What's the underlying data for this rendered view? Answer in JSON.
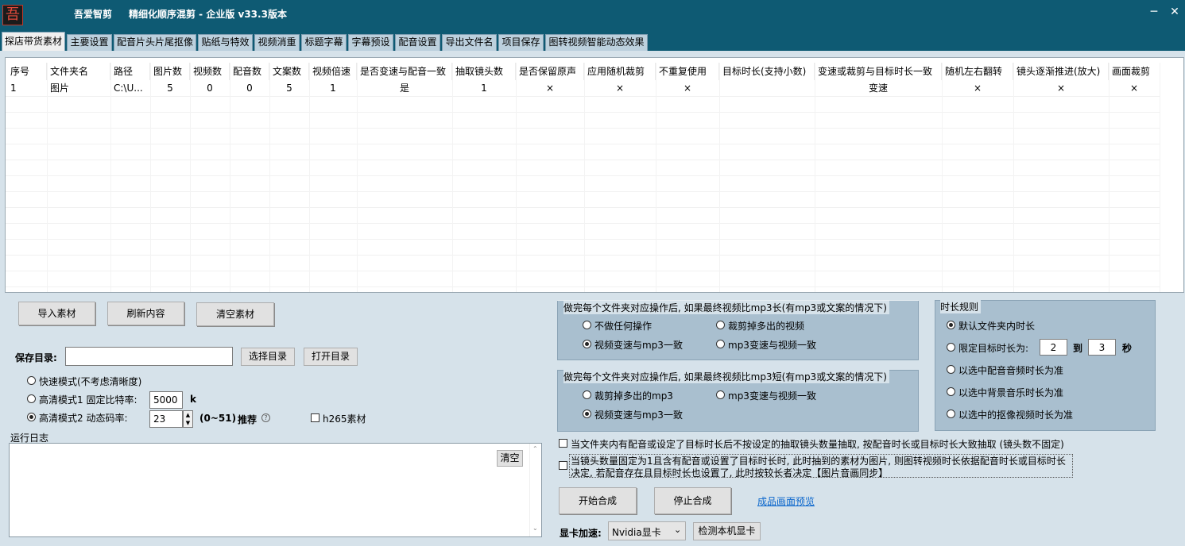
{
  "window": {
    "logo_char": "吾",
    "app_name": "吾爱智剪",
    "title": "精细化顺序混剪 - 企业版  v33.3版本",
    "minimize": "─",
    "close": "✕"
  },
  "tabs": [
    "探店带货素材",
    "主要设置",
    "配音片头片尾抠像",
    "贴纸与特效",
    "视频消重",
    "标题字幕",
    "字幕预设",
    "配音设置",
    "导出文件名",
    "项目保存",
    "图转视频智能动态效果"
  ],
  "table": {
    "headers": [
      "序号",
      "文件夹名",
      "路径",
      "图片数",
      "视频数",
      "配音数",
      "文案数",
      "视频倍速",
      "是否变速与配音一致",
      "抽取镜头数",
      "是否保留原声",
      "应用随机裁剪",
      "不重复使用",
      "目标时长(支持小数)",
      "变速或裁剪与目标时长一致",
      "随机左右翻转",
      "镜头逐渐推进(放大)",
      "画面裁剪"
    ],
    "rows": [
      [
        "1",
        "图片",
        "C:\\U...",
        "5",
        "0",
        "0",
        "5",
        "1",
        "是",
        "1",
        "×",
        "×",
        "×",
        "",
        "变速",
        "×",
        "×",
        "×"
      ]
    ]
  },
  "buttons": {
    "import": "导入素材",
    "refresh": "刷新内容",
    "clear_material": "清空素材",
    "choose_dir": "选择目录",
    "open_dir": "打开目录",
    "clear_log": "清空",
    "start": "开始合成",
    "stop": "停止合成",
    "preview_link": "成品画面预览",
    "detect_gpu": "检测本机显卡"
  },
  "save": {
    "label": "保存目录:",
    "value": ""
  },
  "modes": {
    "fast": "快速模式(不考虑清晰度)",
    "hq1": "高清模式1 固定比特率:",
    "hq1_value": "5000",
    "hq1_unit": "k",
    "hq2": "高清模式2 动态码率:",
    "hq2_value": "23",
    "hq2_range": "(0~51)",
    "hq2_recommend": "推荐",
    "help_icon": "?",
    "h265": "h265素材",
    "selected": "hq2"
  },
  "log": {
    "label": "运行日志",
    "content": ""
  },
  "group_longer": {
    "title": "做完每个文件夹对应操作后, 如果最终视频比mp3长(有mp3或文案的情况下)",
    "options": [
      "不做任何操作",
      "裁剪掉多出的视频",
      "视频变速与mp3一致",
      "mp3变速与视频一致"
    ],
    "selected": 2
  },
  "group_shorter": {
    "title": "做完每个文件夹对应操作后, 如果最终视频比mp3短(有mp3或文案的情况下)",
    "options": [
      "裁剪掉多出的mp3",
      "mp3变速与视频一致",
      "视频变速与mp3一致"
    ],
    "selected": 2
  },
  "duration_rule": {
    "title": "时长规则",
    "options": [
      "默认文件夹内时长",
      "限定目标时长为:",
      "以选中配音音频时长为准",
      "以选中背景音乐时长为准",
      "以选中的抠像视频时长为准"
    ],
    "selected": 0,
    "from": "2",
    "to_label": "到",
    "to": "3",
    "unit": "秒"
  },
  "checks": {
    "c1": "当文件夹内有配音或设定了目标时长后不按设定的抽取镜头数量抽取, 按配音时长或目标时长大致抽取 (镜头数不固定)",
    "c2_line1": "当镜头数量固定为1且含有配音或设置了目标时长时, 此时抽到的素材为图片, 则图转视频时长依据配音时长或目标时长",
    "c2_line2": "决定, 若配音存在且目标时长也设置了, 此时按较长者决定【图片音画同步】"
  },
  "gpu": {
    "label": "显卡加速:",
    "value": "Nvidia显卡"
  },
  "colors": {
    "titlebar": "#0e5a73",
    "background": "#d6e2ea",
    "group": "#a9bfcf",
    "link": "#0a66cc"
  }
}
